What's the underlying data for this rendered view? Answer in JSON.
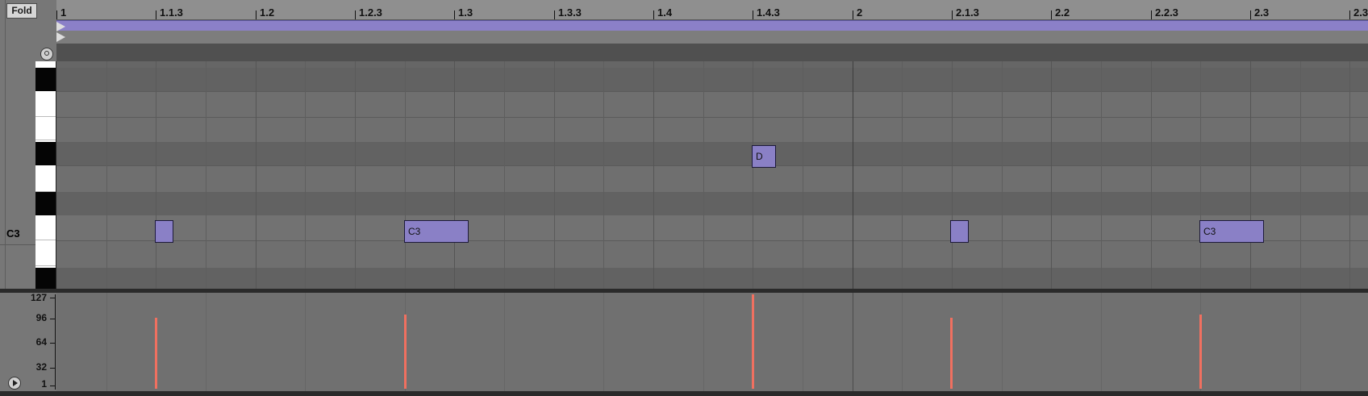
{
  "toolbar": {
    "fold_label": "Fold"
  },
  "piano": {
    "c3_label": "C3"
  },
  "ruler": {
    "labels": [
      "1",
      "1.1.3",
      "1.2",
      "1.2.3",
      "1.3",
      "1.3.3",
      "1.4",
      "1.4.3",
      "2",
      "2.1.3",
      "2.2",
      "2.2.3",
      "2.3",
      "2.3"
    ]
  },
  "notes": [
    {
      "label": "",
      "pitch": "C3"
    },
    {
      "label": "C3",
      "pitch": "C3"
    },
    {
      "label": "D",
      "pitch": "D3"
    },
    {
      "label": "",
      "pitch": "C3"
    },
    {
      "label": "C3",
      "pitch": "C3"
    }
  ],
  "velocity": {
    "scale_labels": [
      "127",
      "96",
      "64",
      "32",
      "1"
    ],
    "values": [
      96,
      100,
      127,
      96,
      100
    ],
    "bar_color": "#f07060"
  },
  "colors": {
    "note_fill": "#8a80c6",
    "loop_bar": "#8b80c8"
  }
}
